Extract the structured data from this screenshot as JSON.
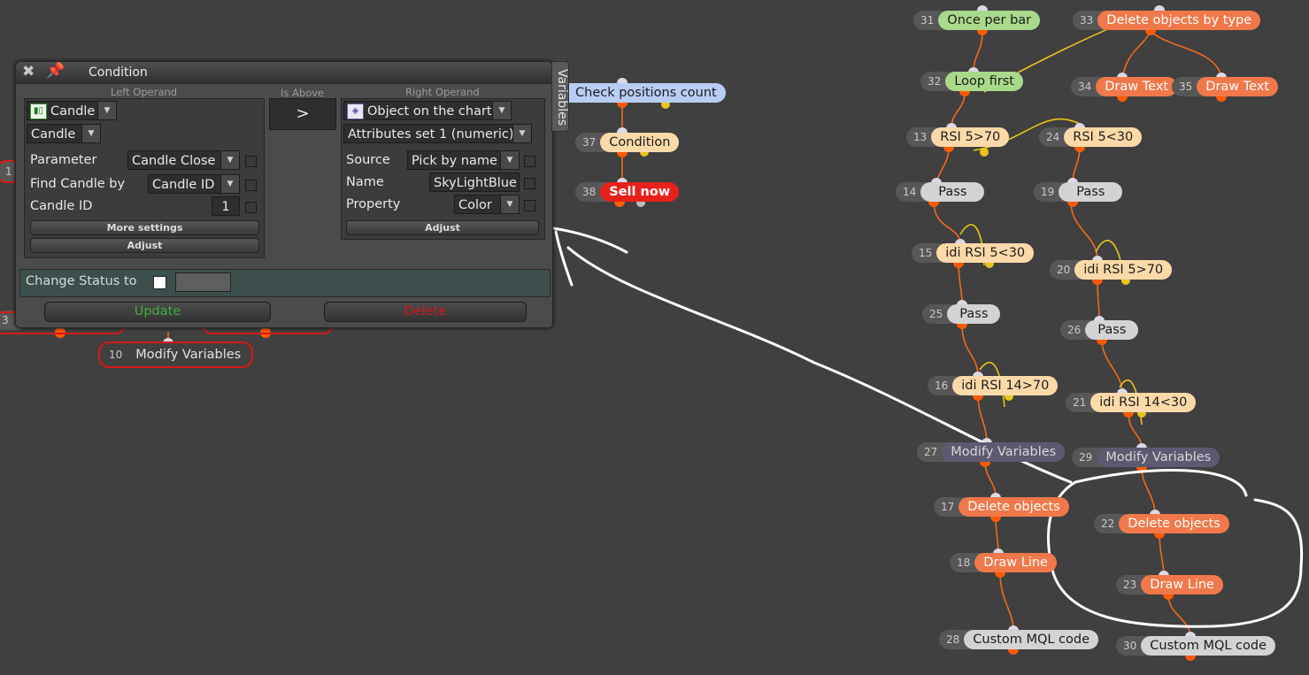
{
  "panel": {
    "title": "Condition",
    "left_header": "Left Operand",
    "operator_header": "Is Above",
    "right_header": "Right Operand",
    "operator": ">",
    "side_tab": "Variables",
    "left": {
      "type": "Candle",
      "subtype": "Candle",
      "param_label": "Parameter",
      "param_value": "Candle Close",
      "find_label": "Find Candle by",
      "find_value": "Candle ID",
      "id_label": "Candle ID",
      "id_value": "1",
      "more_settings": "More settings",
      "adjust": "Adjust"
    },
    "right": {
      "type": "Object on the chart",
      "subtype": "Attributes set 1 (numeric)",
      "source_label": "Source",
      "source_value": "Pick by name",
      "name_label": "Name",
      "name_value": "SkyLightBlue",
      "property_label": "Property",
      "property_value": "Color",
      "adjust": "Adjust"
    },
    "change_status_label": "Change Status to",
    "update": "Update",
    "delete": "Delete"
  },
  "nodes": {
    "n1": {
      "num": "1",
      "label": ""
    },
    "n3": {
      "num": "3",
      "label": ""
    },
    "n10": {
      "num": "10",
      "label": "Modify Variables"
    },
    "n36": {
      "num": "",
      "label": "Check positions count"
    },
    "n37": {
      "num": "37",
      "label": "Condition"
    },
    "n38": {
      "num": "38",
      "label": "Sell now"
    },
    "n31": {
      "num": "31",
      "label": "Once per bar"
    },
    "n32": {
      "num": "32",
      "label": "Loop first"
    },
    "n33": {
      "num": "33",
      "label": "Delete objects by type"
    },
    "n34": {
      "num": "34",
      "label": "Draw Text"
    },
    "n35": {
      "num": "35",
      "label": "Draw Text"
    },
    "n13": {
      "num": "13",
      "label": "RSI 5>70"
    },
    "n24": {
      "num": "24",
      "label": "RSI 5<30"
    },
    "n14": {
      "num": "14",
      "label": "Pass"
    },
    "n19": {
      "num": "19",
      "label": "Pass"
    },
    "n15": {
      "num": "15",
      "label": "idi RSI 5<30"
    },
    "n20": {
      "num": "20",
      "label": "idi RSI 5>70"
    },
    "n25": {
      "num": "25",
      "label": "Pass"
    },
    "n26": {
      "num": "26",
      "label": "Pass"
    },
    "n16": {
      "num": "16",
      "label": "idi RSI 14>70"
    },
    "n21": {
      "num": "21",
      "label": "idi RSI 14<30"
    },
    "n27": {
      "num": "27",
      "label": "Modify Variables"
    },
    "n29": {
      "num": "29",
      "label": "Modify Variables"
    },
    "n17": {
      "num": "17",
      "label": "Delete objects"
    },
    "n22": {
      "num": "22",
      "label": "Delete objects"
    },
    "n18": {
      "num": "18",
      "label": "Draw Line"
    },
    "n23": {
      "num": "23",
      "label": "Draw Line"
    },
    "n28": {
      "num": "28",
      "label": "Custom MQL code"
    },
    "n30": {
      "num": "30",
      "label": "Custom MQL code"
    }
  },
  "colors": {
    "background": "#404040",
    "connector_orange": "#f06a1c",
    "connector_yellow": "#e8c41c",
    "update_text": "#3fae3f",
    "delete_text": "#d81818"
  }
}
